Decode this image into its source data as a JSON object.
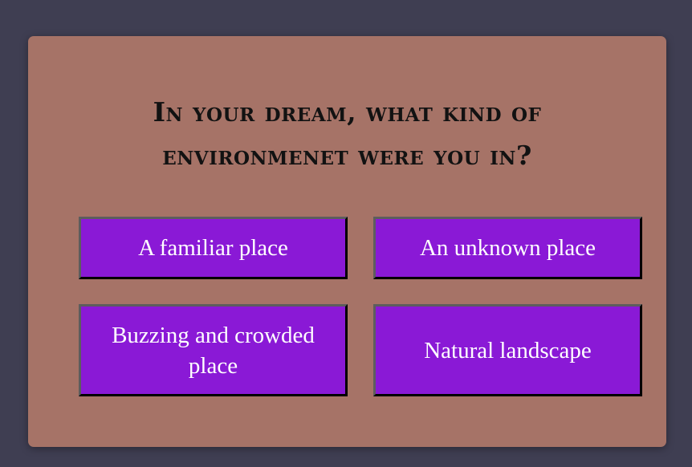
{
  "quiz": {
    "question_line1": "In your dream, what kind of",
    "question_line2": "environmenet were you in?",
    "answers": [
      {
        "label": "A familiar place"
      },
      {
        "label": "An unknown place"
      },
      {
        "label": "Buzzing and crowded place"
      },
      {
        "label": "Natural landscape"
      }
    ]
  },
  "colors": {
    "page_background": "#3f3e52",
    "card_background": "#a67367",
    "answer_background": "#8a19d6",
    "answer_text": "#ffffff",
    "question_text": "#121212"
  }
}
